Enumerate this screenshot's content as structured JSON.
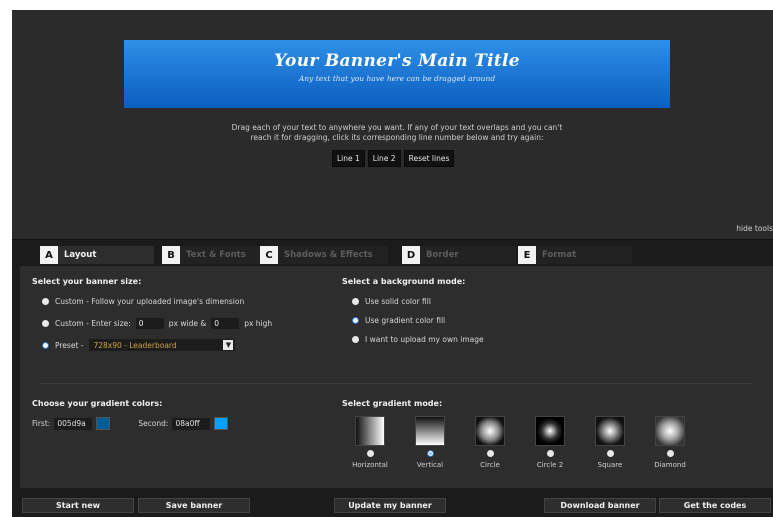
{
  "banner": {
    "title": "Your Banner's Main Title",
    "subtitle": "Any text that you have here can be dragged around",
    "gradient_start": "#2f8fe6",
    "gradient_end": "#0b5ec0"
  },
  "instructions": {
    "line1": "Drag each of your text to anywhere you want. If any of your text overlaps and you can't",
    "line2": "reach it for dragging, click its corresponding line number below and try again:"
  },
  "line_buttons": [
    "Line 1",
    "Line 2",
    "Reset lines"
  ],
  "hide_tools": "hide tools",
  "tabs": [
    {
      "letter": "A",
      "label": "Layout",
      "active": true
    },
    {
      "letter": "B",
      "label": "Text & Fonts",
      "active": false
    },
    {
      "letter": "C",
      "label": "Shadows & Effects",
      "active": false
    },
    {
      "letter": "D",
      "label": "Border",
      "active": false
    },
    {
      "letter": "E",
      "label": "Format",
      "active": false
    }
  ],
  "size": {
    "title": "Select your banner size:",
    "option_custom_image": "Custom - Follow your uploaded image's dimension",
    "option_custom_enter": "Custom - Enter size:",
    "width_value": "0",
    "px_wide": "px wide &",
    "height_value": "0",
    "px_high": "px high",
    "option_preset": "Preset -",
    "preset_value": "728x90 - Leaderboard",
    "selected": "preset"
  },
  "background": {
    "title": "Select a background mode:",
    "option_solid": "Use solid color fill",
    "option_gradient": "Use gradient color fill",
    "option_upload": "I want to upload my own image",
    "selected": "gradient"
  },
  "gradient_colors": {
    "title": "Choose your gradient colors:",
    "first_label": "First:",
    "first_value": "005d9a",
    "second_label": "Second:",
    "second_value": "08a0ff",
    "first_swatch": "#005d9a",
    "second_swatch": "#08a0ff"
  },
  "gradient_mode": {
    "title": "Select gradient mode:",
    "modes": [
      "Horizontal",
      "Vertical",
      "Circle",
      "Circle 2",
      "Square",
      "Diamond"
    ],
    "selected": "Vertical"
  },
  "bottom_buttons": {
    "start_new": "Start new",
    "save_banner": "Save banner",
    "update_banner": "Update my banner",
    "download_banner": "Download banner",
    "get_codes": "Get the codes"
  }
}
